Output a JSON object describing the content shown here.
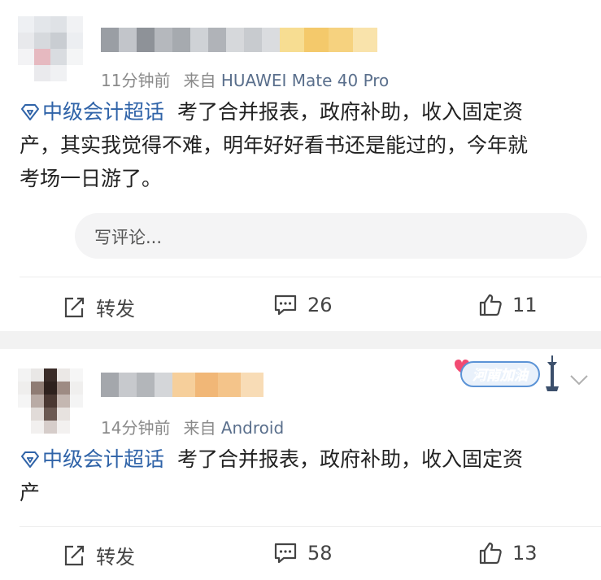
{
  "posts": [
    {
      "time": "11分钟前",
      "source_prefix": "来自",
      "source": "HUAWEI Mate 40 Pro",
      "topic": "中级会计超话",
      "text_line1": "考了合并报表，政府补助，收入固定资",
      "text_line2": "产，其实我觉得不难，明年好好看书还是能过的，今年就",
      "text_line3": "考场一日游了。",
      "repost_label": "转发",
      "comment_count": "26",
      "like_count": "11"
    },
    {
      "time": "14分钟前",
      "source_prefix": "来自",
      "source": "Android",
      "topic": "中级会计超话",
      "text_line1": "考了合并报表，政府补助，收入固定资",
      "text_line2": "产",
      "repost_label": "转发",
      "comment_count": "58",
      "like_count": "13"
    }
  ],
  "comment_placeholder": "写评论...",
  "badge_text": "河南加油",
  "colors": {
    "link_blue": "#2f63a8",
    "meta_gray": "#8a8a8a",
    "separator": "#f2f2f2"
  },
  "icons": [
    "topic-diamond-icon",
    "repost-icon",
    "comment-icon",
    "like-icon",
    "chevron-down-icon"
  ]
}
